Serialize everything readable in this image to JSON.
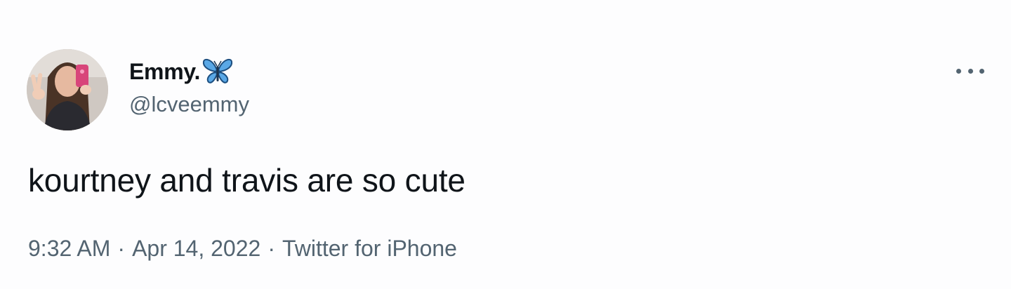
{
  "tweet": {
    "display_name": "Emmy.",
    "handle": "@lcveemmy",
    "text": "kourtney and travis are so cute",
    "time": "9:32 AM",
    "separator": "·",
    "date": "Apr 14, 2022",
    "source": "Twitter for iPhone"
  },
  "icons": {
    "emoji": "butterfly-icon",
    "more": "more-options-icon"
  },
  "colors": {
    "primary_text": "#0f1419",
    "secondary_text": "#536471",
    "background": "#fdfdfe",
    "butterfly": "#5aa8e6"
  }
}
